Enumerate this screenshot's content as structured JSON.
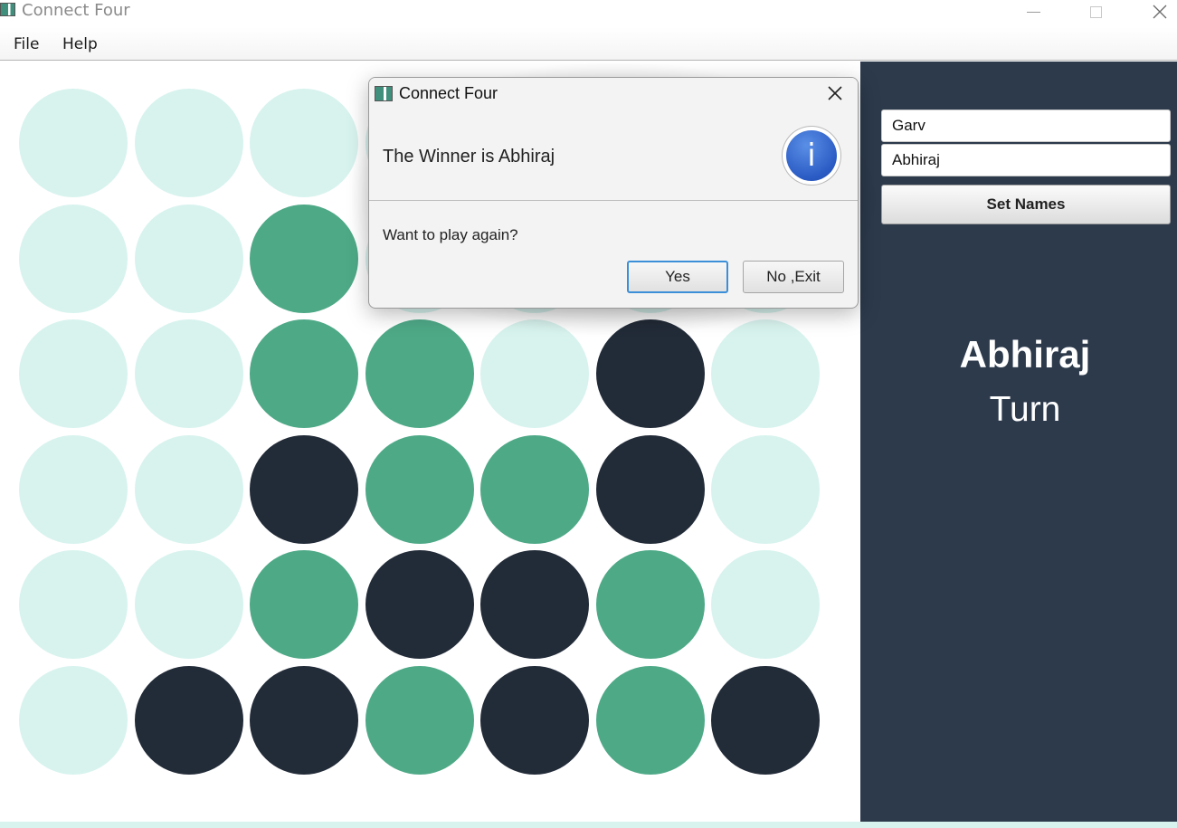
{
  "window": {
    "title": "Connect Four"
  },
  "menu": {
    "file_label": "File",
    "help_label": "Help"
  },
  "board": {
    "rows": 6,
    "cols": 7,
    "cells": [
      [
        "empty",
        "empty",
        "empty",
        "empty",
        "empty",
        "empty",
        "empty"
      ],
      [
        "empty",
        "empty",
        "green",
        "empty",
        "empty",
        "empty",
        "empty"
      ],
      [
        "empty",
        "empty",
        "green",
        "green",
        "empty",
        "dark",
        "empty"
      ],
      [
        "empty",
        "empty",
        "dark",
        "green",
        "green",
        "dark",
        "empty"
      ],
      [
        "empty",
        "empty",
        "green",
        "dark",
        "dark",
        "green",
        "empty"
      ],
      [
        "empty",
        "dark",
        "dark",
        "green",
        "dark",
        "green",
        "dark"
      ]
    ],
    "colors": {
      "empty": "#d8f3ee",
      "green": "#4ea987",
      "dark": "#222b38"
    }
  },
  "side_panel": {
    "player1_name": "Garv",
    "player2_name": "Abhiraj",
    "set_names_label": "Set Names",
    "current_player": "Abhiraj",
    "turn_label": "Turn",
    "background": "#2c3a4c"
  },
  "dialog": {
    "title": "Connect Four",
    "header_text": "The Winner is Abhiraj",
    "icon": "info-icon",
    "question": "Want to play again?",
    "yes_label": "Yes",
    "no_exit_label": "No ,Exit"
  }
}
